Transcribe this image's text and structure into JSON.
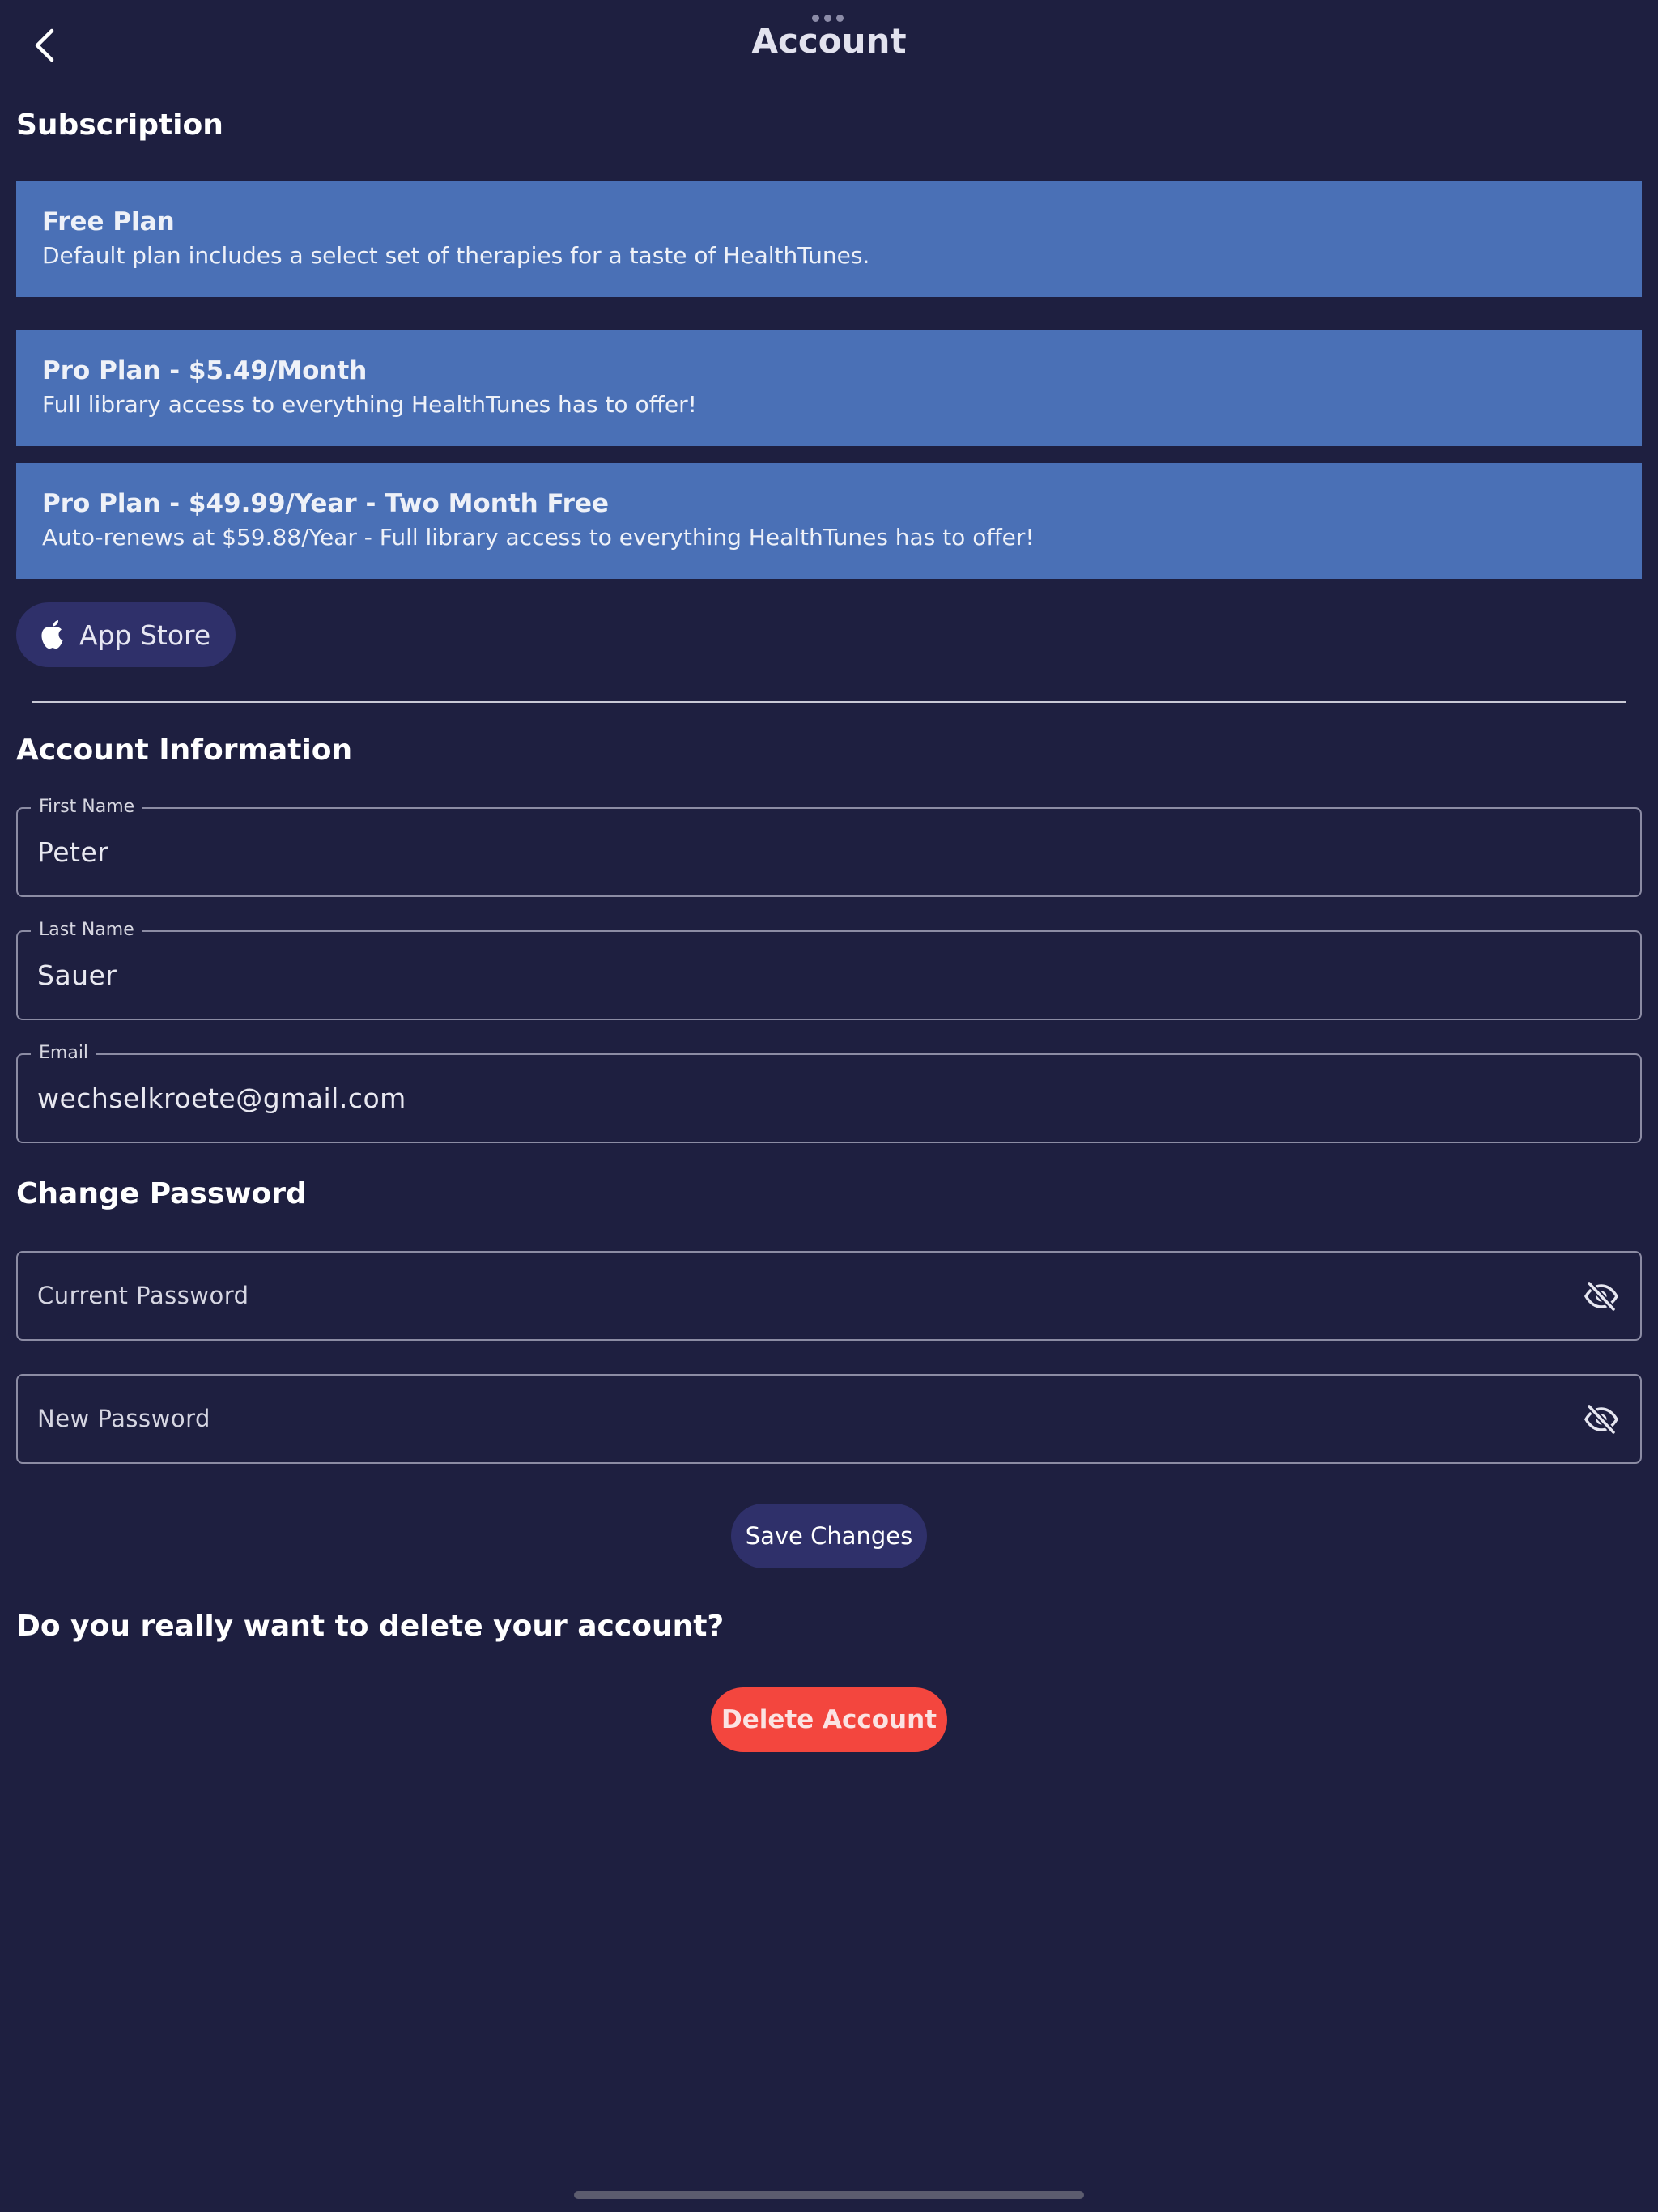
{
  "header": {
    "title": "Account"
  },
  "subscription": {
    "title": "Subscription",
    "plans": [
      {
        "name": "Free Plan",
        "description": "Default plan includes a select set of therapies for a taste of HealthTunes."
      },
      {
        "name": "Pro Plan - $5.49/Month",
        "description": "Full library access to everything HealthTunes has to offer!"
      },
      {
        "name": "Pro Plan - $49.99/Year - Two Month Free",
        "description": "Auto-renews at $59.88/Year - Full library access to everything HealthTunes has to offer!"
      }
    ],
    "store_button_label": "App Store",
    "store_icon": "apple-icon"
  },
  "account_info": {
    "title": "Account Information",
    "first_name": {
      "label": "First Name",
      "value": "Peter"
    },
    "last_name": {
      "label": "Last Name",
      "value": "Sauer"
    },
    "email": {
      "label": "Email",
      "value": "wechselkroete@gmail.com"
    }
  },
  "change_password": {
    "title": "Change Password",
    "current_password": {
      "placeholder": "Current Password",
      "icon": "eye-off-icon"
    },
    "new_password": {
      "placeholder": "New Password",
      "icon": "eye-off-icon"
    },
    "save_label": "Save Changes"
  },
  "delete_account": {
    "question": "Do you really want to delete your account?",
    "button_label": "Delete Account"
  },
  "colors": {
    "background": "#1e1f40",
    "plan_card": "#4a70b6",
    "pill_button": "#2f306a",
    "danger": "#f3463e"
  }
}
